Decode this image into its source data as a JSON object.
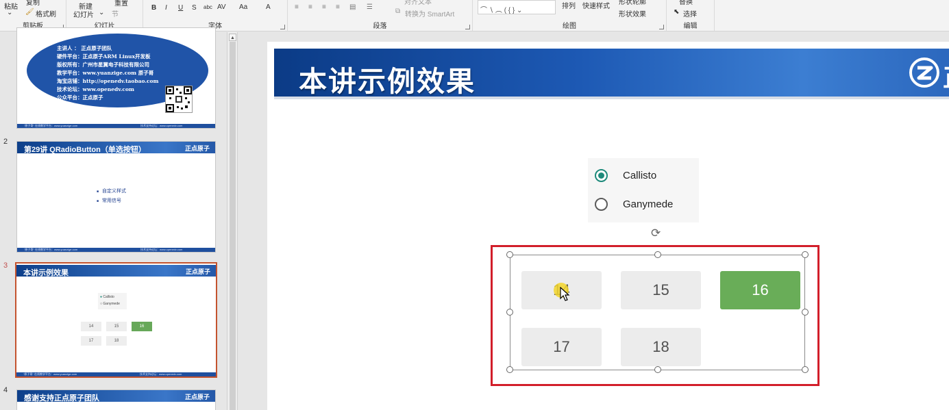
{
  "ribbon": {
    "clipboard": {
      "paste_label": "粘贴",
      "copy_label": "复制",
      "format_painter_label": "格式刷",
      "group_label": "剪贴板"
    },
    "slides": {
      "new_slide_label": "新建",
      "new_slide_label2": "幻灯片",
      "reset_label": "重置",
      "section_label": "节",
      "group_label": "幻灯片"
    },
    "font": {
      "group_label": "字体",
      "bold": "B",
      "italic": "I",
      "underline": "U",
      "strike": "S",
      "char_spacing": "abc",
      "spacing": "AV",
      "case": "Aa",
      "color": "A"
    },
    "paragraph": {
      "group_label": "段落",
      "text_direction": "对齐文本",
      "smartart": "转换为 SmartArt"
    },
    "drawing": {
      "group_label": "绘图",
      "arrange_label": "排列",
      "quick_styles_label": "快速样式",
      "shape_outline_label": "形状轮廓",
      "shape_effects_label": "形状效果"
    },
    "editing": {
      "group_label": "编辑",
      "replace_label": "替换",
      "select_label": "选择"
    }
  },
  "thumbnails": [
    {
      "number": "",
      "lines": [
        "主讲人 ： 正点原子团队",
        "硬件平台：正点原子ARM Linux开发板",
        "版权所有：广州市星翼电子科技有限公司",
        "教学平台：www.yuanzige.com 原子哥",
        "淘宝店铺：http://openedv.taobao.com",
        "技术论坛：www.openedv.com",
        "公众平台：正点原子"
      ],
      "footer_left": "\"原子哥\" 在线教学平台：www.yuanzige.com",
      "footer_right": "技术支持论坛：www.openedv.com"
    },
    {
      "number": "2",
      "title": "第29讲 QRadioButton（单选按钮）",
      "logo": "正点原子",
      "bullets": [
        "自定义样式",
        "常用信号"
      ],
      "footer_left": "\"原子哥\" 在线教学平台：www.yuanzige.com",
      "footer_right": "技术支持论坛：www.openedv.com"
    },
    {
      "number": "3",
      "title": "本讲示例效果",
      "logo": "正点原子",
      "radios": [
        "Callisto",
        "Ganymede"
      ],
      "buttons": [
        "14",
        "15",
        "16",
        "17",
        "18"
      ],
      "footer_left": "\"原子哥\" 在线教学平台：www.yuanzige.com",
      "footer_right": "技术支持论坛：www.openedv.com"
    },
    {
      "number": "4",
      "title": "感谢支持正点原子团队",
      "logo": "正点原子"
    }
  ],
  "slide": {
    "title": "本讲示例效果",
    "logo_text": "正",
    "radios": [
      {
        "label": "Callisto",
        "checked": true
      },
      {
        "label": "Ganymede",
        "checked": false
      }
    ],
    "buttons": [
      {
        "label": "14",
        "active": false
      },
      {
        "label": "15",
        "active": false
      },
      {
        "label": "16",
        "active": true
      },
      {
        "label": "17",
        "active": false
      },
      {
        "label": "18",
        "active": false
      }
    ],
    "active_color": "#69ad58",
    "radio_color": "#1e8a7b",
    "highlight_color": "#d21e2a"
  }
}
